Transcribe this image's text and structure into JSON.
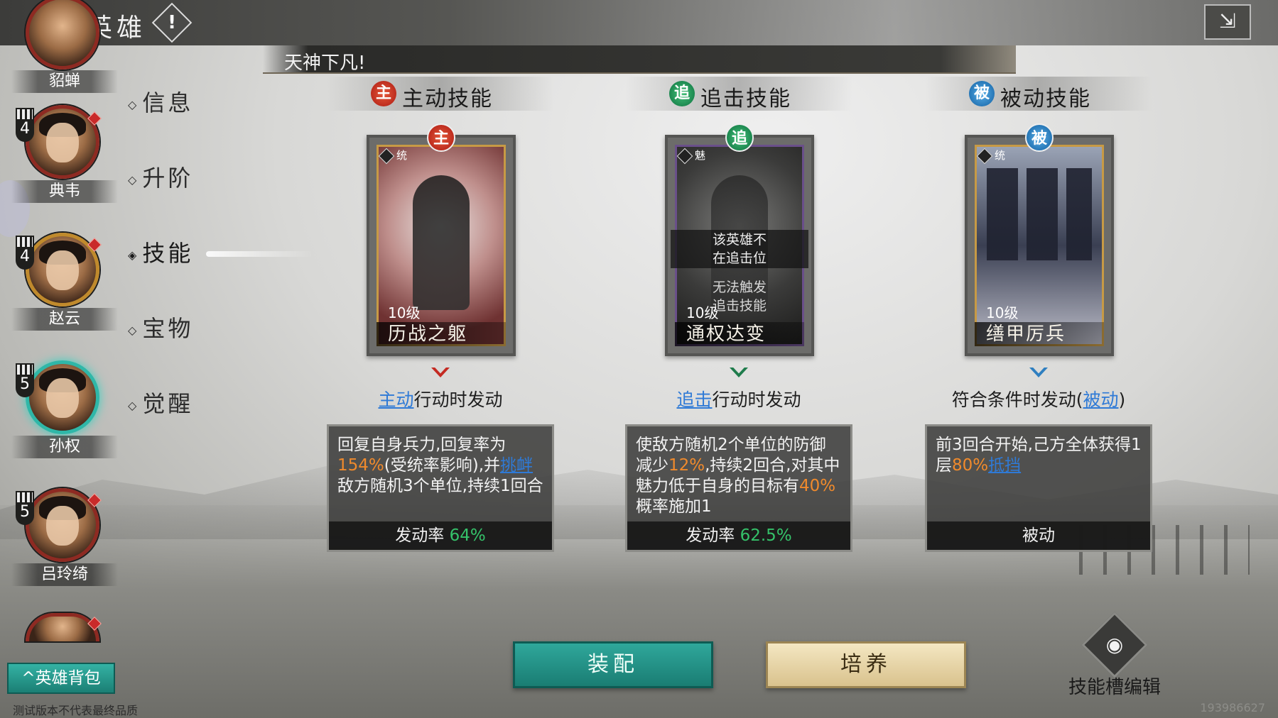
{
  "header": {
    "back_icon": "back-arrow-icon",
    "title": "英雄",
    "info_glyph": "!",
    "exit_icon": "exit-icon"
  },
  "banner": {
    "text": "天神下凡!"
  },
  "hero_list": [
    {
      "name": "貂蝉",
      "rank": "",
      "frame": "red"
    },
    {
      "name": "典韦",
      "rank": "4",
      "frame": "red"
    },
    {
      "name": "赵云",
      "rank": "4",
      "frame": "gold"
    },
    {
      "name": "孙权",
      "rank": "5",
      "frame": "teal",
      "selected": true
    },
    {
      "name": "吕玲绮",
      "rank": "5",
      "frame": "red"
    }
  ],
  "side_nav": [
    {
      "label": "信息",
      "active": false
    },
    {
      "label": "升阶",
      "active": false
    },
    {
      "label": "技能",
      "active": true
    },
    {
      "label": "宝物",
      "active": false
    },
    {
      "label": "觉醒",
      "active": false
    }
  ],
  "skills": [
    {
      "tag": "主",
      "title": "主动技能",
      "color": "#c8321f",
      "attr": "统",
      "level": "10级",
      "name": "历战之躯",
      "trigger_link": "主动",
      "trigger_rest": "行动时发动",
      "desc_parts": [
        {
          "t": "回复自身兵力,回复率为"
        },
        {
          "t": "154%",
          "style": "orange"
        },
        {
          "t": "(受统率影响),并"
        },
        {
          "t": "挑衅",
          "style": "link"
        },
        {
          "t": "敌方随机3个单位,持续1回合"
        }
      ],
      "rate_label": "发动率",
      "rate_value": "64%"
    },
    {
      "tag": "追",
      "title": "追击技能",
      "color": "#1f8a50",
      "attr": "魅",
      "level": "10级",
      "name": "通权达变",
      "overlay_line1": "该英雄不",
      "overlay_line2": "在追击位",
      "overlay2_line1": "无法触发",
      "overlay2_line2": "追击技能",
      "trigger_link": "追击",
      "trigger_rest": "行动时发动",
      "desc_parts": [
        {
          "t": "使敌方随机2个单位的防御减少"
        },
        {
          "t": "12%",
          "style": "orange"
        },
        {
          "t": ",持续2回合,对其中魅力低于自身的目标有"
        },
        {
          "t": "40%",
          "style": "orange"
        },
        {
          "t": "概率施加1"
        }
      ],
      "rate_label": "发动率",
      "rate_value": "62.5%"
    },
    {
      "tag": "被",
      "title": "被动技能",
      "color": "#2a78c0",
      "attr": "统",
      "level": "10级",
      "name": "缮甲厉兵",
      "trigger_prefix": "符合条件时发动(",
      "trigger_link": "被动",
      "trigger_suffix": ")",
      "desc_parts": [
        {
          "t": "前3回合开始,己方全体获得1层"
        },
        {
          "t": "80%",
          "style": "orange"
        },
        {
          "t": "抵挡",
          "style": "link"
        }
      ],
      "rate_label": "被动",
      "rate_value": ""
    }
  ],
  "buttons": {
    "equip": "装配",
    "train": "培养",
    "slot_edit": "技能槽编辑"
  },
  "footer": {
    "bag_label": "^英雄背包",
    "note": "测试版本不代表最终品质",
    "build_id": "193986627"
  }
}
